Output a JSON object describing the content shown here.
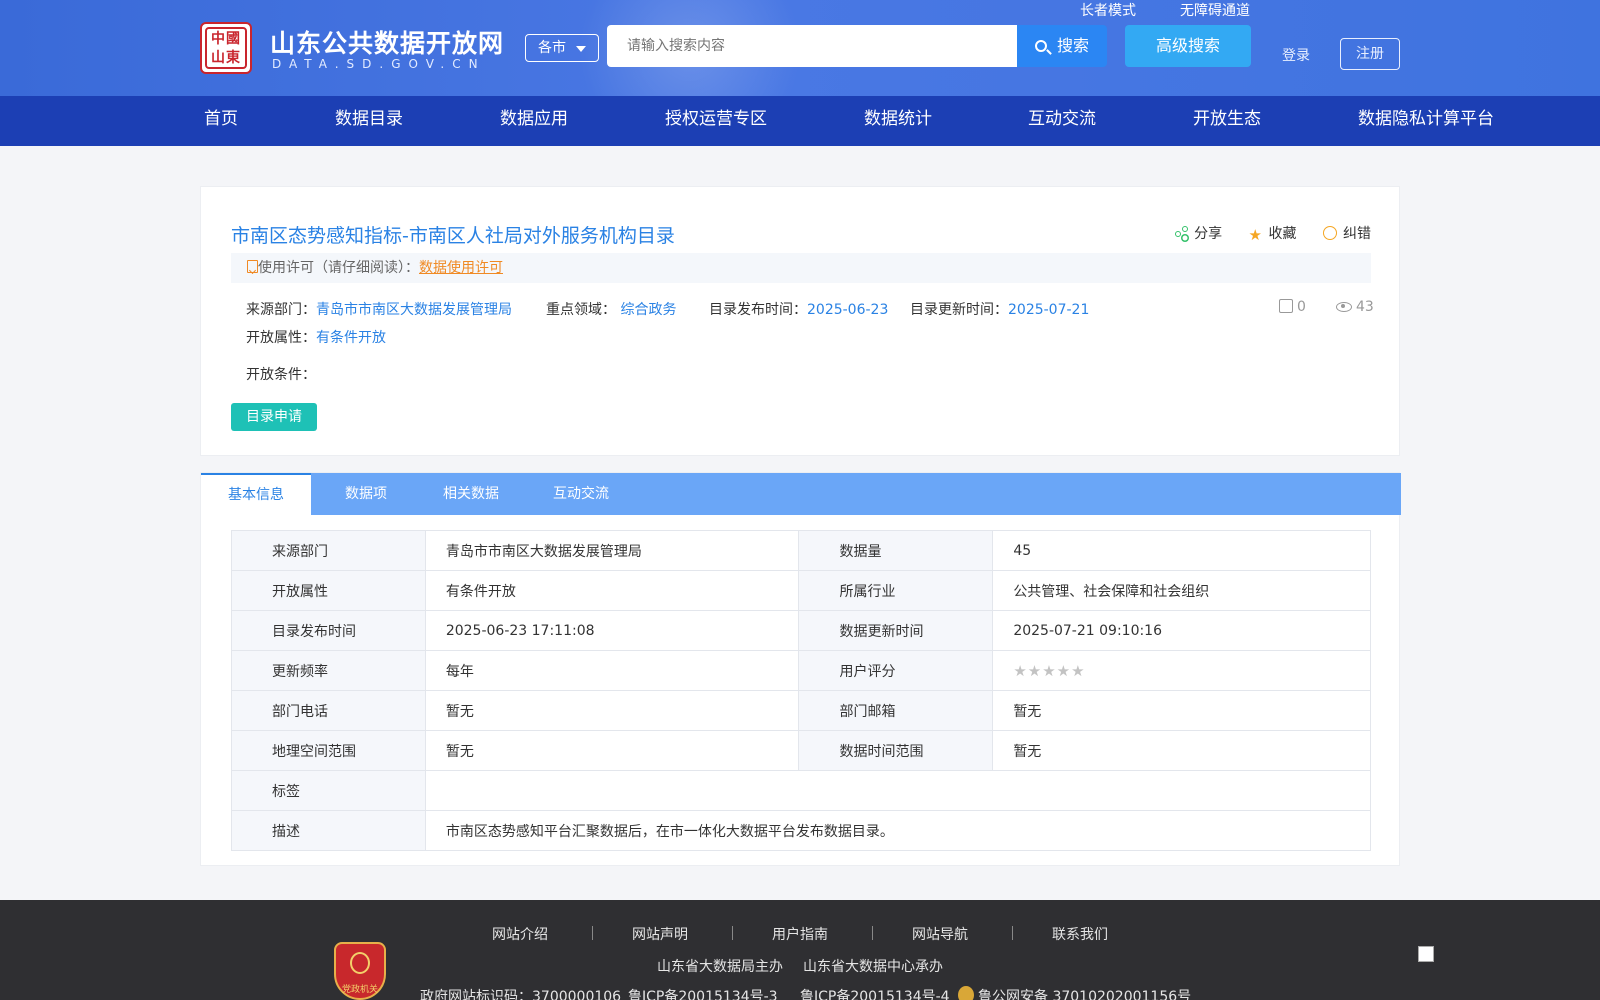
{
  "header": {
    "site_title": "山东公共数据开放网",
    "site_domain": "DATA.SD.GOV.CN",
    "logo_text": "中國山東",
    "city_select": "各市",
    "search_placeholder": "请输入搜索内容",
    "search_button": "搜索",
    "advanced_search": "高级搜索",
    "elder_mode": "长者模式",
    "accessibility": "无障碍通道",
    "login": "登录",
    "register": "注册"
  },
  "nav": [
    "首页",
    "数据目录",
    "数据应用",
    "授权运营专区",
    "数据统计",
    "互动交流",
    "开放生态",
    "数据隐私计算平台"
  ],
  "dataset": {
    "title": "市南区态势感知指标-市南区人社局对外服务机构目录",
    "actions": {
      "share": "分享",
      "favorite": "收藏",
      "report": "纠错"
    },
    "license_label": "使用许可（请仔细阅读）：",
    "license_link": "数据使用许可",
    "source_label": "来源部门：",
    "source_value": "青岛市市南区大数据发展管理局",
    "domain_label": "重点领域：",
    "domain_value": "综合政务",
    "publish_label": "目录发布时间：",
    "publish_value": "2025-06-23",
    "update_label": "目录更新时间：",
    "update_value": "2025-07-21",
    "open_attr_label": "开放属性：",
    "open_attr_value": "有条件开放",
    "open_cond_label": "开放条件：",
    "downloads": "0",
    "views": "43",
    "apply_button": "目录申请"
  },
  "tabs": [
    "基本信息",
    "数据项",
    "相关数据",
    "互动交流"
  ],
  "info_table": {
    "rows": [
      {
        "k1": "来源部门",
        "v1": "青岛市市南区大数据发展管理局",
        "k2": "数据量",
        "v2": "45"
      },
      {
        "k1": "开放属性",
        "v1": "有条件开放",
        "k2": "所属行业",
        "v2": "公共管理、社会保障和社会组织"
      },
      {
        "k1": "目录发布时间",
        "v1": "2025-06-23 17:11:08",
        "k2": "数据更新时间",
        "v2": "2025-07-21 09:10:16"
      },
      {
        "k1": "更新频率",
        "v1": "每年",
        "k2": "用户评分",
        "v2": "★★★★★"
      },
      {
        "k1": "部门电话",
        "v1": "暂无",
        "k2": "部门邮箱",
        "v2": "暂无"
      },
      {
        "k1": "地理空间范围",
        "v1": "暂无",
        "k2": "数据时间范围",
        "v2": "暂无"
      }
    ],
    "tags_label": "标签",
    "tags_value": "",
    "desc_label": "描述",
    "desc_value": "市南区态势感知平台汇聚数据后，在市一体化大数据平台发布数据目录。",
    "user_rating": 0
  },
  "footer": {
    "links": [
      "网站介绍",
      "网站声明",
      "用户指南",
      "网站导航",
      "联系我们"
    ],
    "host": "山东省大数据局主办",
    "organizer": "山东省大数据中心承办",
    "gov_code": "政府网站标识码：3700000106",
    "icp1": "鲁ICP备20015134号-3",
    "icp2": "鲁ICP备20015134号-4",
    "police": "鲁公网安备 37010202001156号",
    "party_badge": "党政机关"
  },
  "colors": {
    "nav_bg": "#1c3fb4",
    "accent": "#2a82e4",
    "tab_bar": "#6aa6f7",
    "apply": "#1ec1b6",
    "license_link": "#f08a24"
  }
}
